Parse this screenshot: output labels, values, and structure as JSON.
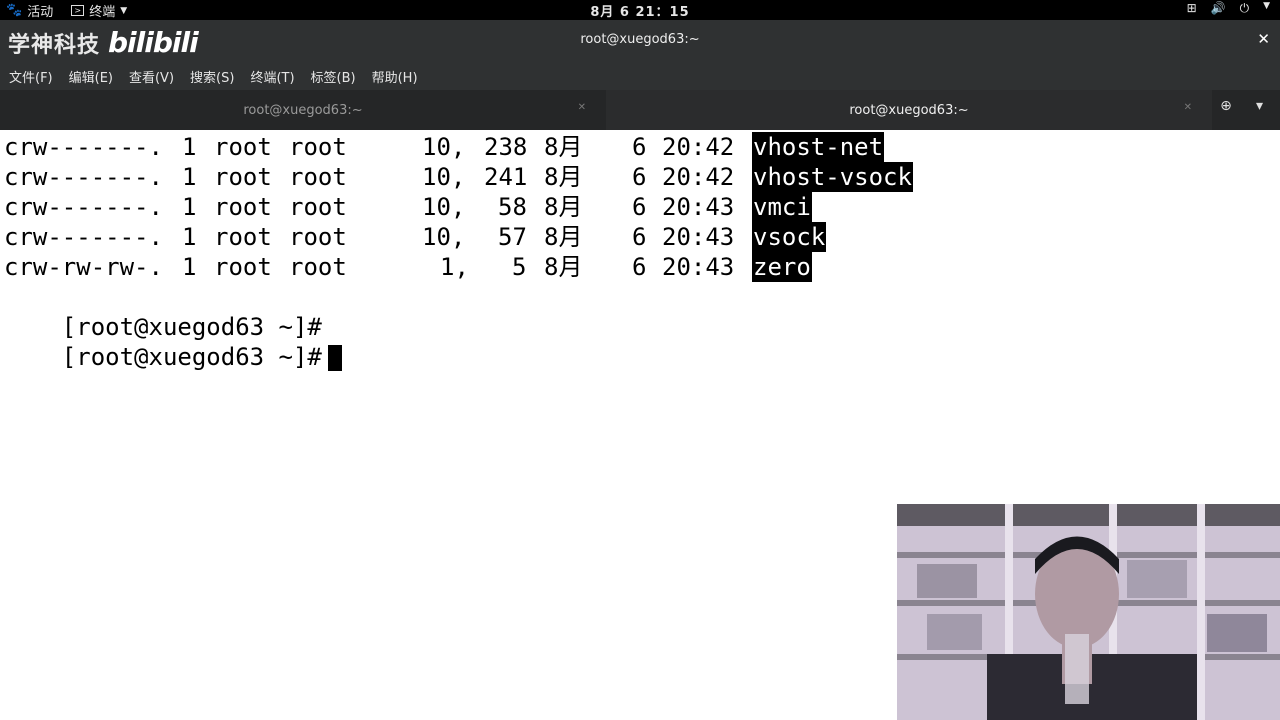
{
  "topbar": {
    "activities_label": "活动",
    "app_label": "终端",
    "clock": "8月 6  21：15"
  },
  "window": {
    "watermark_brand": "学神科技",
    "watermark_logo": "bilibili",
    "title": "root@xuegod63:~"
  },
  "menu": {
    "items": [
      "文件(F)",
      "编辑(E)",
      "查看(V)",
      "搜索(S)",
      "终端(T)",
      "标签(B)",
      "帮助(H)"
    ]
  },
  "tabs": [
    {
      "label": "root@xuegod63:~",
      "active": false
    },
    {
      "label": "root@xuegod63:~",
      "active": true
    }
  ],
  "terminal": {
    "rows": [
      {
        "perm": "crw-------.",
        "links": "1",
        "owner": "root",
        "group": "root",
        "major": "10,",
        "minor": "238",
        "month": "8月",
        "day": "6",
        "time": "20:42",
        "name": "vhost-net"
      },
      {
        "perm": "crw-------.",
        "links": "1",
        "owner": "root",
        "group": "root",
        "major": "10,",
        "minor": "241",
        "month": "8月",
        "day": "6",
        "time": "20:42",
        "name": "vhost-vsock"
      },
      {
        "perm": "crw-------.",
        "links": "1",
        "owner": "root",
        "group": "root",
        "major": "10,",
        "minor": "58",
        "month": "8月",
        "day": "6",
        "time": "20:43",
        "name": "vmci"
      },
      {
        "perm": "crw-------.",
        "links": "1",
        "owner": "root",
        "group": "root",
        "major": "10,",
        "minor": "57",
        "month": "8月",
        "day": "6",
        "time": "20:43",
        "name": "vsock"
      },
      {
        "perm": "crw-rw-rw-.",
        "links": "1",
        "owner": "root",
        "group": "root",
        "major": "1,",
        "minor": "5",
        "month": "8月",
        "day": "6",
        "time": "20:43",
        "name": "zero"
      }
    ],
    "prompts": [
      "[root@xuegod63 ~]#",
      "[root@xuegod63 ~]#"
    ]
  },
  "icons": {
    "activities": "gnome-foot-icon",
    "terminal_app": "terminal-icon",
    "network": "network-icon",
    "volume": "volume-icon",
    "power": "power-icon",
    "close": "close-icon",
    "new_tab": "new-tab-icon",
    "tab_menu": "menu-icon"
  }
}
